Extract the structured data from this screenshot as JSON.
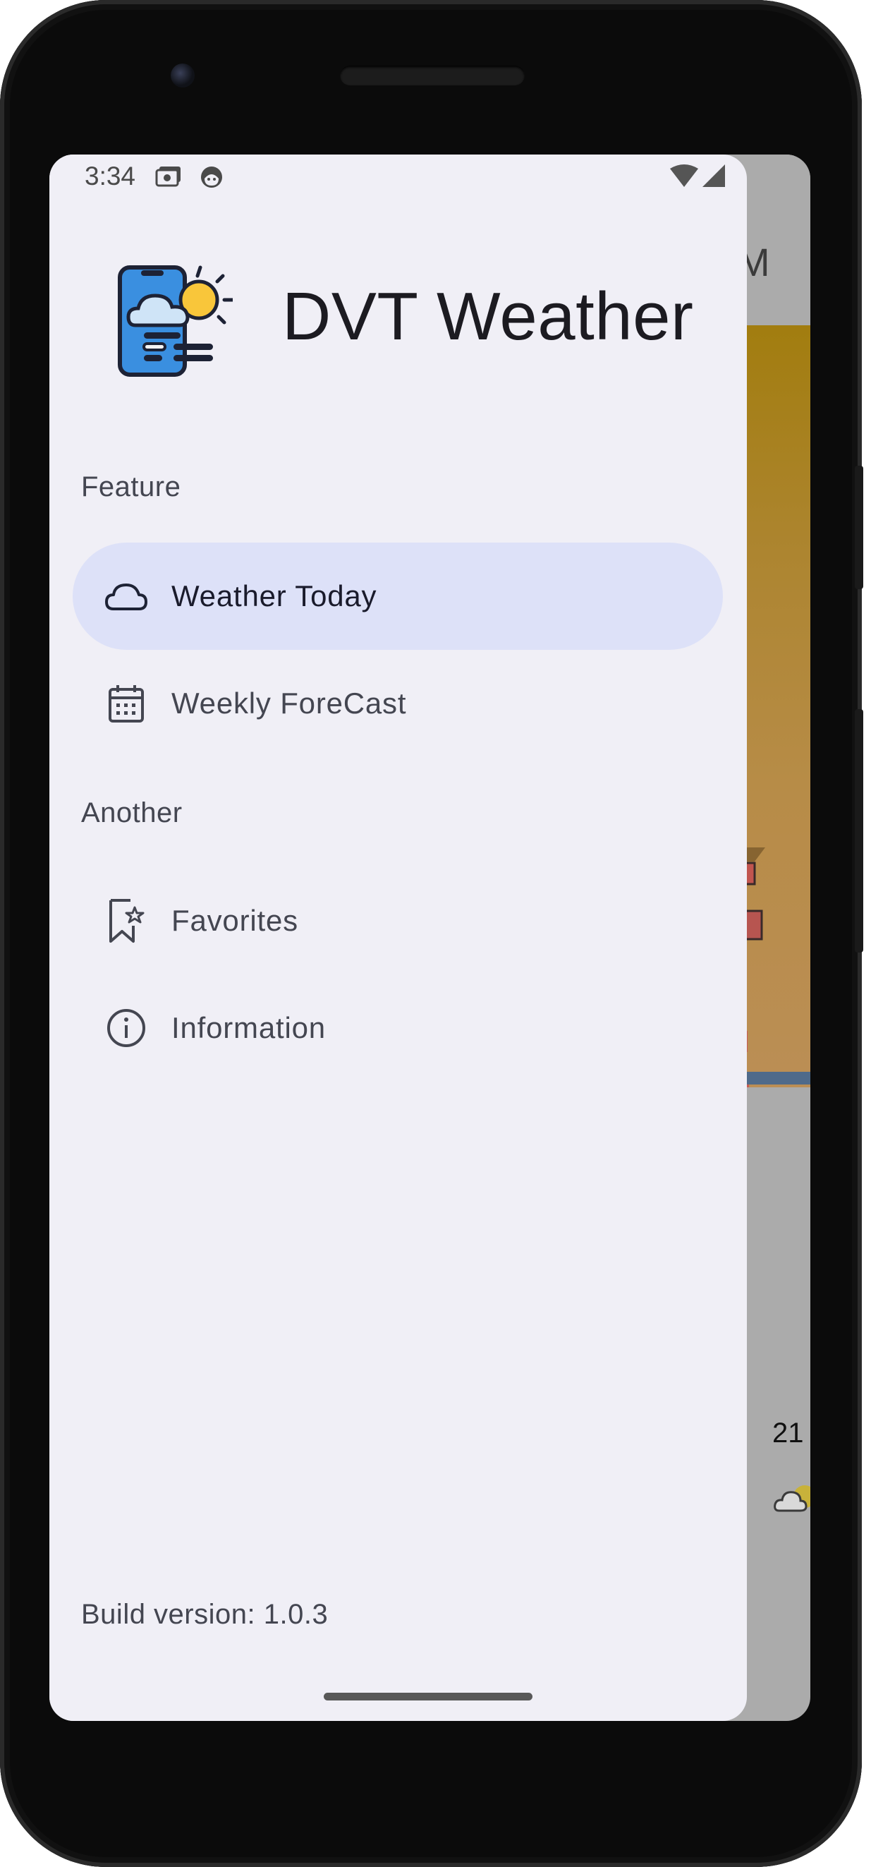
{
  "status_bar": {
    "time": "3:34",
    "left_icons": [
      "photo-card-icon",
      "face-icon"
    ],
    "right_icons": [
      "wifi-icon",
      "cell-signal-icon"
    ]
  },
  "background_app": {
    "top_bar_fragment": "M",
    "temperature_fragment": "21"
  },
  "drawer": {
    "app_title": "DVT Weather",
    "logo_icon": "phone-weather-logo-icon",
    "sections": [
      {
        "title": "Feature",
        "items": [
          {
            "label": "Weather Today",
            "icon": "cloud-icon",
            "selected": true
          },
          {
            "label": "Weekly ForeCast",
            "icon": "calendar-icon",
            "selected": false
          }
        ]
      },
      {
        "title": "Another",
        "items": [
          {
            "label": "Favorites",
            "icon": "bookmark-star-icon",
            "selected": false
          },
          {
            "label": "Information",
            "icon": "info-icon",
            "selected": false
          }
        ]
      }
    ],
    "build_version": "Build version: 1.0.3"
  },
  "colors": {
    "drawer_bg": "#f0eff6",
    "selected_item_bg": "#dde1f8",
    "scrim": "#ababab",
    "text_primary": "#1c1b21",
    "text_secondary": "#444651"
  }
}
